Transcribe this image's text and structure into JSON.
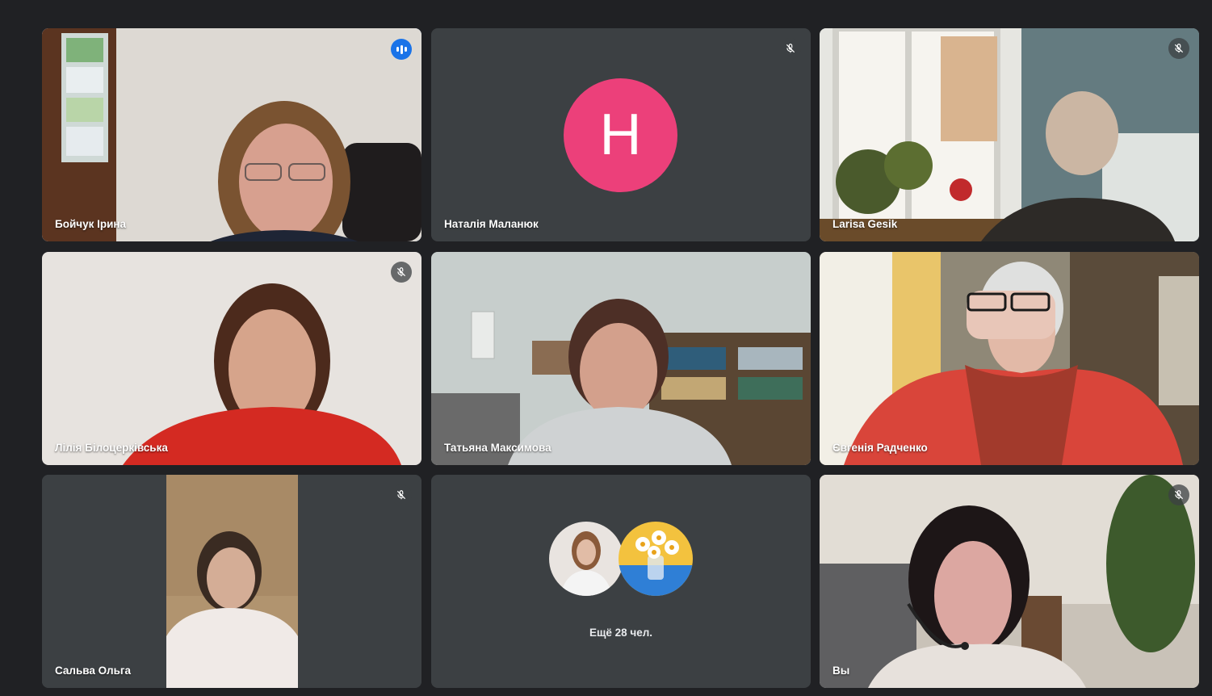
{
  "participants": [
    {
      "name": "Бойчук Ірина",
      "status": "speaking"
    },
    {
      "name": "Наталія Маланюк",
      "status": "muted",
      "initial": "Н",
      "avatar_color": "#ec407a"
    },
    {
      "name": "Larisa Gesik",
      "status": "muted"
    },
    {
      "name": "Лілія Білоцерківська",
      "status": "muted"
    },
    {
      "name": "Татьяна Максимова",
      "status": "unmuted"
    },
    {
      "name": "Євгенія Радченко",
      "status": "unmuted"
    },
    {
      "name": "Сальва Ольга",
      "status": "muted"
    },
    {
      "name": "Вы",
      "status": "muted"
    }
  ],
  "overflow": {
    "label": "Ещё 28 чел."
  },
  "icons": {
    "muted": "mic-off-icon",
    "speaking": "audio-level-icon"
  },
  "colors": {
    "background": "#202124",
    "tile": "#3c4043",
    "active_border": "#8ab4f8",
    "speaking": "#1a73e8"
  }
}
